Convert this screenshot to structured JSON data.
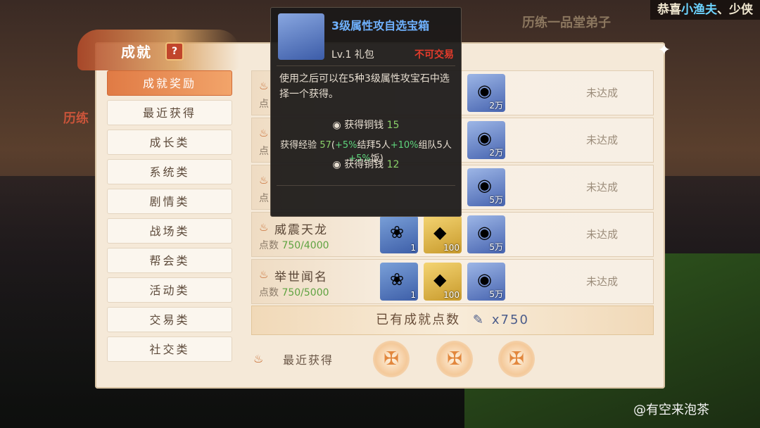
{
  "background": {
    "banner": {
      "prefix": "恭喜",
      "name": "小渔夫",
      "suffix": "、少侠"
    },
    "scene_text": "历练一品堂弟子",
    "red_text": "历练"
  },
  "panel": {
    "title": "成就",
    "help_label": "?",
    "close_label": "✦"
  },
  "sidebar": {
    "items": [
      {
        "label": "成就奖励"
      },
      {
        "label": "最近获得"
      },
      {
        "label": "成长类"
      },
      {
        "label": "系统类"
      },
      {
        "label": "剧情类"
      },
      {
        "label": "战场类"
      },
      {
        "label": "帮会类"
      },
      {
        "label": "活动类"
      },
      {
        "label": "交易类"
      },
      {
        "label": "社交类"
      }
    ]
  },
  "rows": [
    {
      "name": "",
      "points_label": "点",
      "points_value": "",
      "rewards": [
        "bag",
        "",
        "2万"
      ],
      "status": "未达成"
    },
    {
      "name": "",
      "points_label": "点",
      "points_value": "",
      "rewards": [
        "bag",
        "",
        "2万"
      ],
      "status": "未达成"
    },
    {
      "name": "",
      "points_label": "点",
      "points_value": "",
      "rewards": [
        "bag",
        "",
        "5万"
      ],
      "status": "未达成"
    },
    {
      "name": "威震天龙",
      "points_label": "点数",
      "points_value": "750/4000",
      "rewards": [
        "1",
        "100",
        "5万"
      ],
      "status": "未达成"
    },
    {
      "name": "举世闻名",
      "points_label": "点数",
      "points_value": "750/5000",
      "rewards": [
        "1",
        "100",
        "5万"
      ],
      "status": "未达成"
    }
  ],
  "points_bar": {
    "label": "已有成就点数",
    "value": "x750"
  },
  "recent": {
    "label": "最近获得"
  },
  "tooltip": {
    "title": "3级属性攻自选宝箱",
    "level": "Lv.1 礼包",
    "trade": "不可交易",
    "desc": "使用之后可以在5种3级属性攻宝石中选择一个获得。",
    "line1_label": "获得铜钱",
    "line1_value": "15",
    "exp_prefix": "获得经验",
    "exp_value": "57",
    "exp_bonus_a": "+5%",
    "exp_bonus_a_text": "结拜5人",
    "exp_bonus_b": "+10%",
    "exp_bonus_b_text": "组队5人",
    "exp_bonus_c": "+5%",
    "exp_bonus_c_text": "饭)",
    "line3_label": "获得铜钱",
    "line3_value": "12"
  },
  "watermark": "@有空来泡茶",
  "colors": {
    "accent": "#e07b45",
    "tooltip_title": "#6fb2ff",
    "untradable": "#e43b2b"
  }
}
